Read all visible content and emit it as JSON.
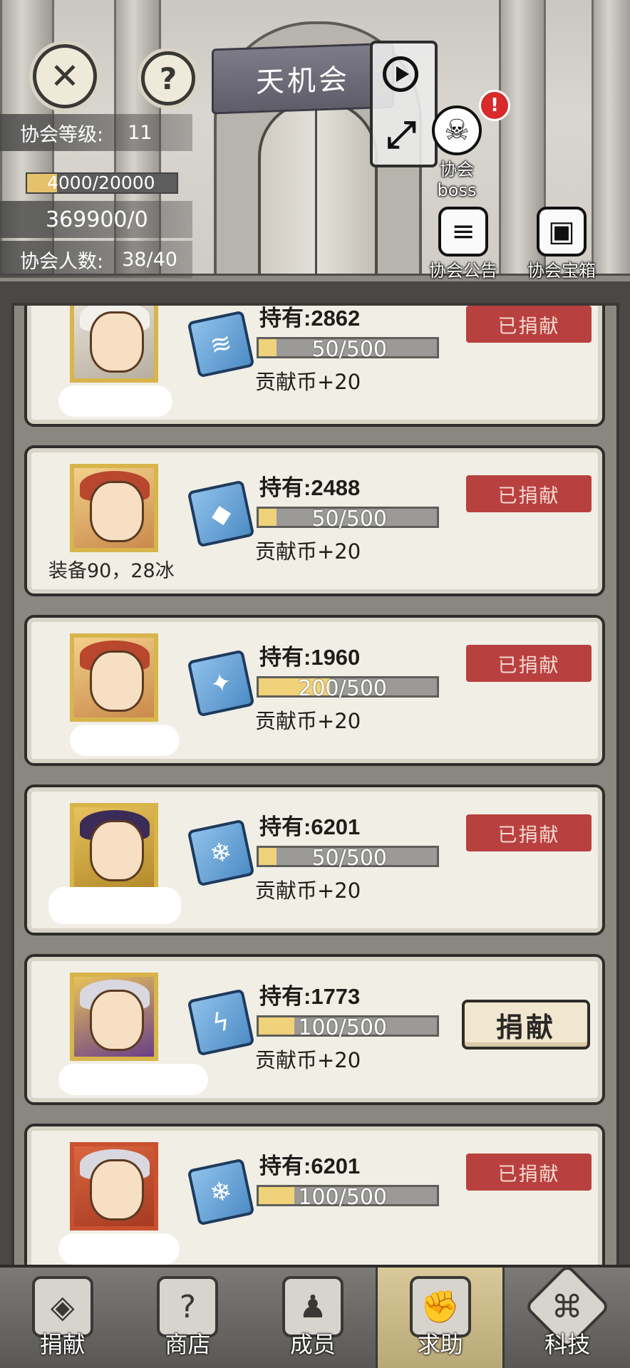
{
  "guild": {
    "name": "天机会",
    "level_label": "协会等级:",
    "level_value": "11",
    "exp_text": "4000/20000",
    "exp_fraction": 0.2,
    "fund_text": "369900/0",
    "members_label": "协会人数:",
    "members_value": "38/40"
  },
  "header_icons": {
    "close": "close-icon",
    "help": "help-icon",
    "boss_label": "协会boss",
    "boss_badge": "!",
    "notice_label": "协会公告",
    "chest_label": "协会宝箱"
  },
  "requests": [
    {
      "name": "",
      "held": "持有:2862",
      "progress": "50/500",
      "fraction": 0.1,
      "reward": "贡献币+20",
      "status": "已捐献",
      "donated": true
    },
    {
      "name": "装备90，28冰",
      "held": "持有:2488",
      "progress": "50/500",
      "fraction": 0.1,
      "reward": "贡献币+20",
      "status": "已捐献",
      "donated": true
    },
    {
      "name": "",
      "held": "持有:1960",
      "progress": "200/500",
      "fraction": 0.4,
      "reward": "贡献币+20",
      "status": "已捐献",
      "donated": true
    },
    {
      "name": "",
      "held": "持有:6201",
      "progress": "50/500",
      "fraction": 0.1,
      "reward": "贡献币+20",
      "status": "已捐献",
      "donated": true
    },
    {
      "name": "",
      "held": "持有:1773",
      "progress": "100/500",
      "fraction": 0.2,
      "reward": "贡献币+20",
      "status": "捐献",
      "donated": false
    },
    {
      "name": "",
      "held": "持有:6201",
      "progress": "100/500",
      "fraction": 0.2,
      "reward": "",
      "status": "已捐献",
      "donated": true
    }
  ],
  "nav": {
    "items": [
      "捐献",
      "商店",
      "成员",
      "求助",
      "科技"
    ],
    "active": "求助"
  },
  "colors": {
    "donated_badge": "#b8413f",
    "progress_fill": "#f0d27a",
    "card_bg": "#f1eee5",
    "portrait_frame": "#d8b54b"
  }
}
